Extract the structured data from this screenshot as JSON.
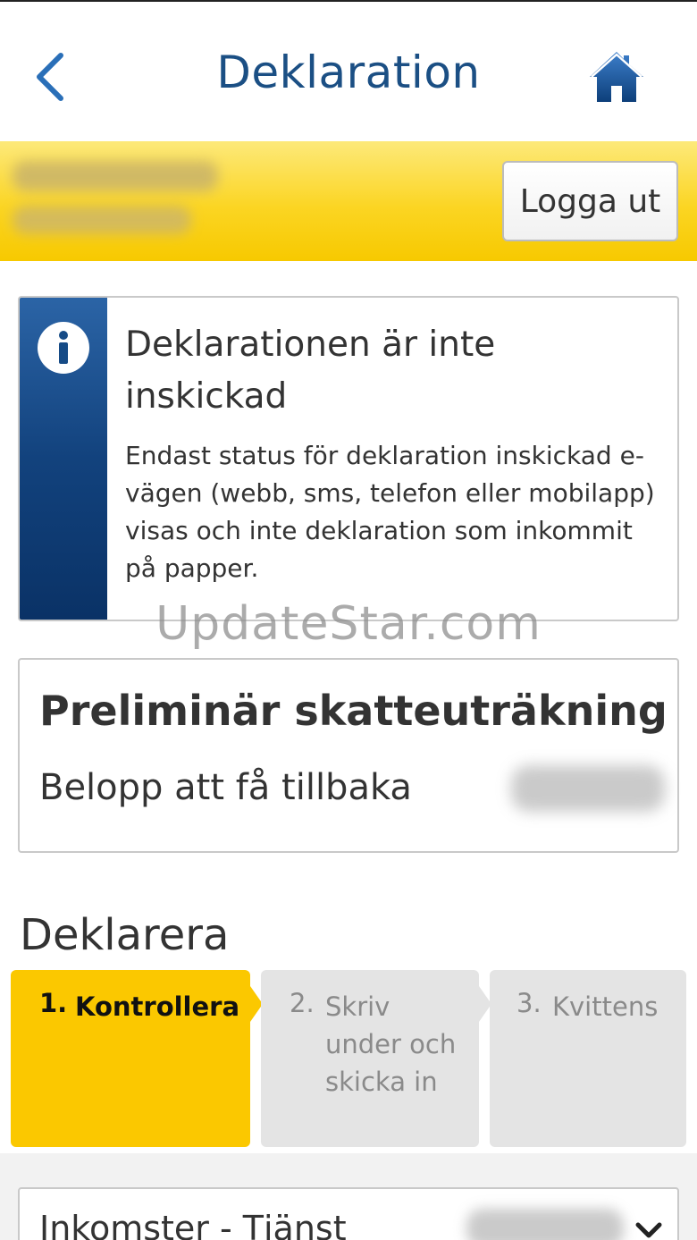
{
  "header": {
    "title": "Deklaration",
    "back_icon": "chevron-left-icon",
    "home_icon": "home-icon"
  },
  "userbar": {
    "logout_label": "Logga ut"
  },
  "info_box": {
    "icon": "info-icon",
    "title": "Deklarationen är inte inskickad",
    "text": "Endast status för deklaration inskickad e-vägen (webb, sms, telefon eller mobilapp) visas och inte deklaration som inkommit på papper."
  },
  "watermark": "UpdateStar.com",
  "tax_card": {
    "title": "Preliminär skatteuträkning",
    "label": "Belopp att få tillbaka"
  },
  "declare": {
    "heading": "Deklarera",
    "steps": [
      {
        "num": "1.",
        "label": "Kontrollera",
        "active": true
      },
      {
        "num": "2.",
        "label": "Skriv under och skicka in",
        "active": false
      },
      {
        "num": "3.",
        "label": "Kvittens",
        "active": false
      }
    ]
  },
  "income_row": {
    "label": "Inkomster - Tjänst",
    "icon": "chevron-down-icon"
  },
  "colors": {
    "brand_blue": "#1b4f84",
    "accent_yellow": "#fbc800",
    "step_inactive": "#e4e4e4"
  }
}
